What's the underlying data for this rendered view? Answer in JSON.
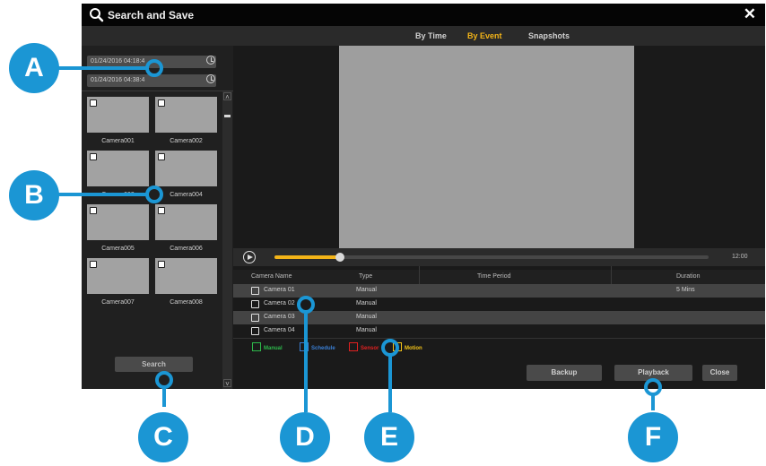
{
  "window": {
    "title": "Search and Save",
    "close_glyph": "✕"
  },
  "tabs": [
    {
      "label": "By Time",
      "active": false
    },
    {
      "label": "By Event",
      "active": true
    },
    {
      "label": "Snapshots",
      "active": false
    }
  ],
  "date_range": {
    "start": "01/24/2016 04:18:4",
    "end": "01/24/2016 04:38:4"
  },
  "cameras": [
    {
      "label": "Camera001"
    },
    {
      "label": "Camera002"
    },
    {
      "label": "Camera003"
    },
    {
      "label": "Camera004"
    },
    {
      "label": "Camera005"
    },
    {
      "label": "Camera006"
    },
    {
      "label": "Camera007"
    },
    {
      "label": "Camera008"
    }
  ],
  "search_button": "Search",
  "timeline": {
    "end_time": "12:00",
    "progress": 0.15
  },
  "table": {
    "headers": [
      "Camera Name",
      "Type",
      "Time Period",
      "Duration"
    ],
    "rows": [
      {
        "camera": "Camera 01",
        "type": "Manual",
        "period": "",
        "duration": "5 Mins"
      },
      {
        "camera": "Camera 02",
        "type": "Manual",
        "period": "",
        "duration": ""
      },
      {
        "camera": "Camera 03",
        "type": "Manual",
        "period": "",
        "duration": ""
      },
      {
        "camera": "Camera 04",
        "type": "Manual",
        "period": "",
        "duration": ""
      }
    ]
  },
  "legend": [
    {
      "label": "Manual",
      "color": "#2db84b"
    },
    {
      "label": "Schedule",
      "color": "#3a7fd5"
    },
    {
      "label": "Sensor",
      "color": "#e02020"
    },
    {
      "label": "Motion",
      "color": "#f3c318"
    }
  ],
  "buttons": {
    "backup": "Backup",
    "playback": "Playback",
    "close": "Close"
  },
  "callouts": [
    "A",
    "B",
    "C",
    "D",
    "E",
    "F"
  ],
  "colors": {
    "accent": "#f3b418",
    "callout": "#1b96d4"
  }
}
